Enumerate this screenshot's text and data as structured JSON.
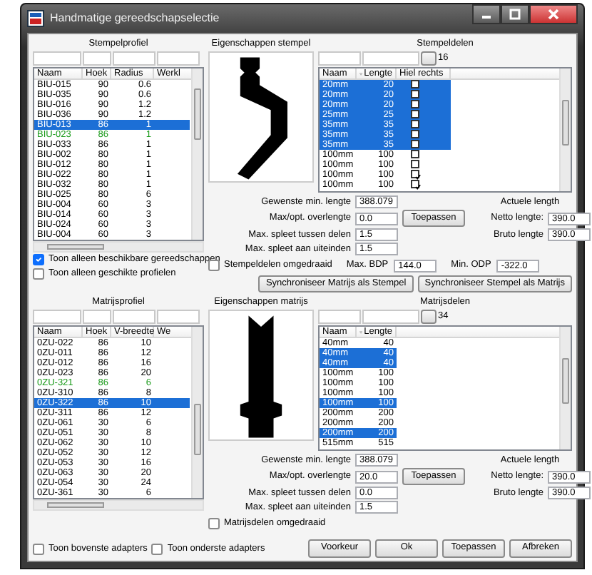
{
  "window": {
    "title": "Handmatige gereedschapselectie"
  },
  "stempel": {
    "profile": {
      "title": "Stempelprofiel",
      "columns": [
        "Naam",
        "Hoek",
        "Radius",
        "Werkl"
      ],
      "rows": [
        {
          "cells": [
            "BIU-015",
            "90",
            "0.6"
          ],
          "selected": false,
          "highlighted": false
        },
        {
          "cells": [
            "BIU-035",
            "90",
            "0.6"
          ],
          "selected": false,
          "highlighted": false
        },
        {
          "cells": [
            "BIU-016",
            "90",
            "1.2"
          ],
          "selected": false,
          "highlighted": false
        },
        {
          "cells": [
            "BIU-036",
            "90",
            "1.2"
          ],
          "selected": false,
          "highlighted": false
        },
        {
          "cells": [
            "BIU-013",
            "86",
            "1"
          ],
          "selected": true,
          "highlighted": false
        },
        {
          "cells": [
            "BIU-023",
            "86",
            "1"
          ],
          "selected": false,
          "highlighted": true
        },
        {
          "cells": [
            "BIU-033",
            "86",
            "1"
          ],
          "selected": false,
          "highlighted": false
        },
        {
          "cells": [
            "BIU-002",
            "80",
            "1"
          ],
          "selected": false,
          "highlighted": false
        },
        {
          "cells": [
            "BIU-012",
            "80",
            "1"
          ],
          "selected": false,
          "highlighted": false
        },
        {
          "cells": [
            "BIU-022",
            "80",
            "1"
          ],
          "selected": false,
          "highlighted": false
        },
        {
          "cells": [
            "BIU-032",
            "80",
            "1"
          ],
          "selected": false,
          "highlighted": false
        },
        {
          "cells": [
            "BIU-025",
            "80",
            "6"
          ],
          "selected": false,
          "highlighted": false
        },
        {
          "cells": [
            "BIU-004",
            "60",
            "3"
          ],
          "selected": false,
          "highlighted": false
        },
        {
          "cells": [
            "BIU-014",
            "60",
            "3"
          ],
          "selected": false,
          "highlighted": false
        },
        {
          "cells": [
            "BIU-024",
            "60",
            "3"
          ],
          "selected": false,
          "highlighted": false
        },
        {
          "cells": [
            "BIU-004",
            "60",
            "3"
          ],
          "selected": false,
          "highlighted": false
        }
      ]
    },
    "filters": [
      {
        "label": "Toon alleen beschikbare gereedschappen",
        "checked": true
      },
      {
        "label": "Toon alleen geschikte profielen",
        "checked": false
      }
    ],
    "properties": {
      "title": "Eigenschappen stempel",
      "flip": {
        "label": "Stempeldelen omgedraaid",
        "checked": false
      },
      "limits": [
        {
          "label": "Max. BDP",
          "value": "144.0"
        },
        {
          "label": "Min. ODP",
          "value": "-322.0"
        }
      ]
    },
    "parts": {
      "title": "Stempeldelen",
      "count": "16",
      "columns": [
        "Naam",
        "Lengte",
        "Hiel rechts"
      ],
      "rows": [
        {
          "name": "20mm",
          "length": "20",
          "selected": true,
          "heel_right": false
        },
        {
          "name": "20mm",
          "length": "20",
          "selected": true,
          "heel_right": false
        },
        {
          "name": "20mm",
          "length": "20",
          "selected": true,
          "heel_right": false
        },
        {
          "name": "25mm",
          "length": "25",
          "selected": true,
          "heel_right": false
        },
        {
          "name": "35mm",
          "length": "35",
          "selected": true,
          "heel_right": false
        },
        {
          "name": "35mm",
          "length": "35",
          "selected": true,
          "heel_right": false
        },
        {
          "name": "35mm",
          "length": "35",
          "selected": true,
          "heel_right": false
        },
        {
          "name": "100mm",
          "length": "100",
          "selected": false,
          "heel_right": false
        },
        {
          "name": "100mm",
          "length": "100",
          "selected": false,
          "heel_right": false
        },
        {
          "name": "100mm",
          "length": "100",
          "selected": false,
          "heel_right": true
        },
        {
          "name": "100mm",
          "length": "100",
          "selected": false,
          "heel_right": true
        }
      ]
    },
    "settings": {
      "fields": [
        {
          "label": "Gewenste min. lengte",
          "value": "388.079"
        },
        {
          "label": "Max/opt. overlengte",
          "value": "0.0"
        },
        {
          "label": "Max. spleet tussen delen",
          "value": "1.5"
        },
        {
          "label": "Max. spleet aan uiteinden",
          "value": "1.5"
        }
      ],
      "apply_button": "Toepassen",
      "actual_title": "Actuele length",
      "netto": {
        "label": "Netto lengte:",
        "value": "390.0"
      },
      "bruto": {
        "label": "Bruto lengte",
        "value": "390.0"
      }
    },
    "sync_buttons": [
      "Synchroniseer Matrijs als Stempel",
      "Synchroniseer Stempel als Matrijs"
    ]
  },
  "matrijs": {
    "profile": {
      "title": "Matrijsprofiel",
      "columns": [
        "Naam",
        "Hoek",
        "V-breedte",
        "We"
      ],
      "rows": [
        {
          "cells": [
            "0ZU-022",
            "86",
            "10"
          ],
          "selected": false,
          "highlighted": false
        },
        {
          "cells": [
            "0ZU-011",
            "86",
            "12"
          ],
          "selected": false,
          "highlighted": false
        },
        {
          "cells": [
            "0ZU-012",
            "86",
            "16"
          ],
          "selected": false,
          "highlighted": false
        },
        {
          "cells": [
            "0ZU-023",
            "86",
            "20"
          ],
          "selected": false,
          "highlighted": false
        },
        {
          "cells": [
            "0ZU-321",
            "86",
            "6"
          ],
          "selected": false,
          "highlighted": true
        },
        {
          "cells": [
            "0ZU-310",
            "86",
            "8"
          ],
          "selected": false,
          "highlighted": false
        },
        {
          "cells": [
            "0ZU-322",
            "86",
            "10"
          ],
          "selected": true,
          "highlighted": false
        },
        {
          "cells": [
            "0ZU-311",
            "86",
            "12"
          ],
          "selected": false,
          "highlighted": false
        },
        {
          "cells": [
            "0ZU-061",
            "30",
            "6"
          ],
          "selected": false,
          "highlighted": false
        },
        {
          "cells": [
            "0ZU-051",
            "30",
            "8"
          ],
          "selected": false,
          "highlighted": false
        },
        {
          "cells": [
            "0ZU-062",
            "30",
            "10"
          ],
          "selected": false,
          "highlighted": false
        },
        {
          "cells": [
            "0ZU-052",
            "30",
            "12"
          ],
          "selected": false,
          "highlighted": false
        },
        {
          "cells": [
            "0ZU-053",
            "30",
            "16"
          ],
          "selected": false,
          "highlighted": false
        },
        {
          "cells": [
            "0ZU-063",
            "30",
            "20"
          ],
          "selected": false,
          "highlighted": false
        },
        {
          "cells": [
            "0ZU-054",
            "30",
            "24"
          ],
          "selected": false,
          "highlighted": false
        },
        {
          "cells": [
            "0ZU-361",
            "30",
            "6"
          ],
          "selected": false,
          "highlighted": false
        }
      ]
    },
    "properties": {
      "title": "Eigenschappen matrijs",
      "flip": {
        "label": "Matrijsdelen omgedraaid",
        "checked": false
      }
    },
    "parts": {
      "title": "Matrijsdelen",
      "count": "34",
      "columns": [
        "Naam",
        "Lengte"
      ],
      "rows": [
        {
          "name": "40mm",
          "length": "40",
          "selected": false
        },
        {
          "name": "40mm",
          "length": "40",
          "selected": true
        },
        {
          "name": "40mm",
          "length": "40",
          "selected": true
        },
        {
          "name": "100mm",
          "length": "100",
          "selected": false
        },
        {
          "name": "100mm",
          "length": "100",
          "selected": false
        },
        {
          "name": "100mm",
          "length": "100",
          "selected": false
        },
        {
          "name": "100mm",
          "length": "100",
          "selected": true
        },
        {
          "name": "200mm",
          "length": "200",
          "selected": false
        },
        {
          "name": "200mm",
          "length": "200",
          "selected": false
        },
        {
          "name": "200mm",
          "length": "200",
          "selected": true
        },
        {
          "name": "515mm",
          "length": "515",
          "selected": false
        }
      ]
    },
    "settings": {
      "fields": [
        {
          "label": "Gewenste min. lengte",
          "value": "388.079"
        },
        {
          "label": "Max/opt. overlengte",
          "value": "20.0"
        },
        {
          "label": "Max. spleet tussen delen",
          "value": "0.0"
        },
        {
          "label": "Max. spleet aan uiteinden",
          "value": "1.5"
        }
      ],
      "apply_button": "Toepassen",
      "actual_title": "Actuele length",
      "netto": {
        "label": "Netto lengte:",
        "value": "390.0"
      },
      "bruto": {
        "label": "Bruto lengte",
        "value": "390.0"
      }
    }
  },
  "adapters": [
    {
      "label": "Toon bovenste adapters",
      "checked": false
    },
    {
      "label": "Toon onderste adapters",
      "checked": false
    }
  ],
  "buttons": [
    "Voorkeur",
    "Ok",
    "Toepassen",
    "Afbreken"
  ]
}
